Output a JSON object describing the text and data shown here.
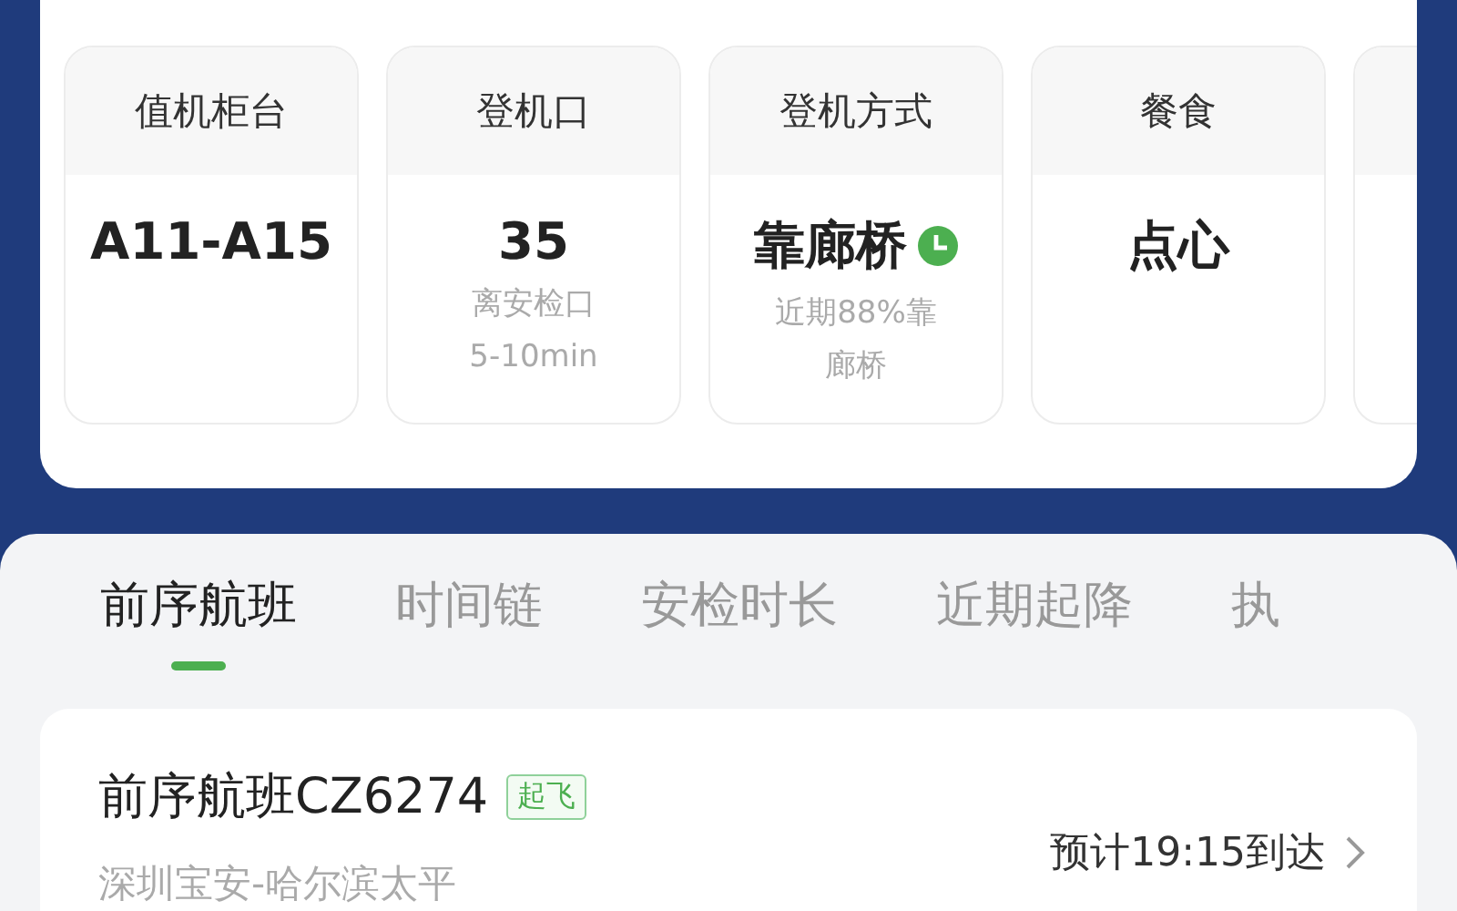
{
  "info_cards": [
    {
      "kind": "plain",
      "label": "值机柜台",
      "value": "A11-A15"
    },
    {
      "kind": "plain",
      "label": "登机口",
      "value": "35",
      "note": [
        "离安检口",
        "5-10min"
      ]
    },
    {
      "kind": "timed",
      "label": "登机方式",
      "value": "靠廊桥",
      "note": [
        "近期88%靠",
        "廊桥"
      ]
    },
    {
      "kind": "plain",
      "label": "餐食",
      "value": "点心"
    }
  ],
  "tabs": [
    {
      "label": "前序航班",
      "selected": true
    },
    {
      "label": "时间链",
      "selected": false
    },
    {
      "label": "安检时长",
      "selected": false
    },
    {
      "label": "近期起降",
      "selected": false
    },
    {
      "label": "执",
      "selected": false
    }
  ],
  "flight": {
    "title": "前序航班CZ6274",
    "status": "起飞",
    "eta": "预计19:15到达",
    "route": "深圳宝安-哈尔滨太平"
  }
}
